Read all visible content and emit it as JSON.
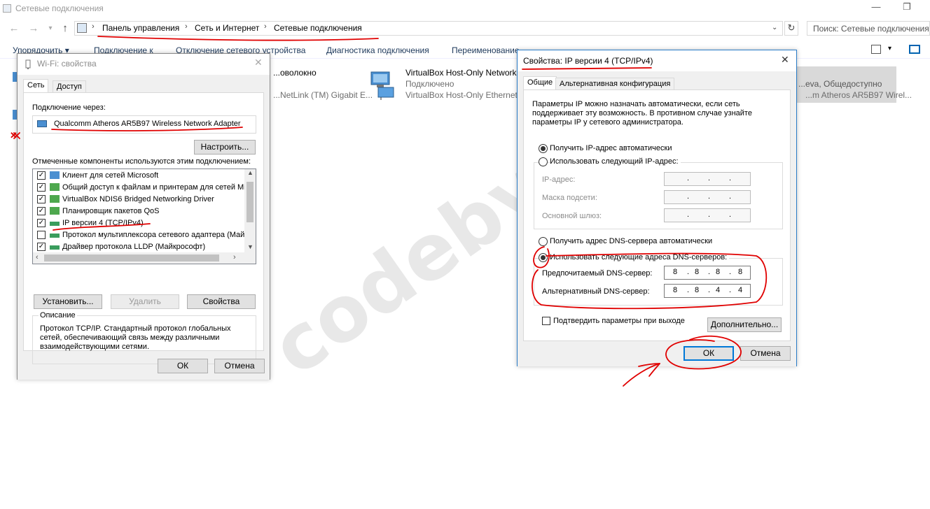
{
  "explorer": {
    "title": "Сетевые подключения",
    "breadcrumb": [
      "Панель управления",
      "Сеть и Интернет",
      "Сетевые подключения"
    ],
    "search_placeholder": "Поиск: Сетевые подключения",
    "commands": [
      "Упорядочить ▾",
      "Подключение к",
      "Отключение сетевого устройства",
      "Диагностика подключения",
      "Переименование"
    ],
    "items": [
      {
        "name": "...оволокно",
        "sub": "...NetLink (TM) Gigabit E..."
      },
      {
        "name": "VirtualBox Host-Only Network",
        "status": "Подключено",
        "sub": "VirtualBox Host-Only Ethernet"
      },
      {
        "name": "...eva, Общедоступно",
        "sub": "...m Atheros AR5B97 Wirel..."
      }
    ]
  },
  "wifi_dialog": {
    "title": "Wi-Fi: свойства",
    "tabs": [
      "Сеть",
      "Доступ"
    ],
    "connect_via_label": "Подключение через:",
    "adapter": "Qualcomm Atheros AR5B97 Wireless Network Adapter",
    "configure_button": "Настроить...",
    "components_label": "Отмеченные компоненты используются этим подключением:",
    "components": [
      {
        "name": "Клиент для сетей Microsoft",
        "checked": true,
        "icon": "network-client-icon"
      },
      {
        "name": "Общий доступ к файлам и принтерам для сетей Mi",
        "checked": true,
        "icon": "network-service-icon"
      },
      {
        "name": "VirtualBox NDIS6 Bridged Networking Driver",
        "checked": true,
        "icon": "network-service-icon"
      },
      {
        "name": "Планировщик пакетов QoS",
        "checked": true,
        "icon": "network-service-icon"
      },
      {
        "name": "IP версии 4 (TCP/IPv4)",
        "checked": true,
        "icon": "protocol-icon"
      },
      {
        "name": "Протокол мультиплексора сетевого адаптера (Май",
        "checked": false,
        "icon": "protocol-icon"
      },
      {
        "name": "Драйвер протокола LLDP (Майкрософт)",
        "checked": true,
        "icon": "protocol-icon"
      }
    ],
    "install_button": "Установить...",
    "remove_button": "Удалить",
    "properties_button": "Свойства",
    "description_title": "Описание",
    "description": "Протокол TCP/IP. Стандартный протокол глобальных сетей, обеспечивающий связь между различными взаимодействующими сетями.",
    "ok": "ОК",
    "cancel": "Отмена"
  },
  "ipv4_dialog": {
    "title": "Свойства: IP версии 4 (TCP/IPv4)",
    "tabs": [
      "Общие",
      "Альтернативная конфигурация"
    ],
    "info": "Параметры IP можно назначать автоматически, если сеть поддерживает эту возможность. В противном случае узнайте параметры IP у сетевого администратора.",
    "ip_auto": "Получить IP-адрес автоматически",
    "ip_manual": "Использовать следующий IP-адрес:",
    "ip_address_label": "IP-адрес:",
    "subnet_label": "Маска подсети:",
    "gateway_label": "Основной шлюз:",
    "dns_auto": "Получить адрес DNS-сервера автоматически",
    "dns_manual": "Использовать следующие адреса DNS-серверов:",
    "preferred_dns_label": "Предпочитаемый DNS-сервер:",
    "preferred_dns": [
      "8",
      "8",
      "8",
      "8"
    ],
    "alternate_dns_label": "Альтернативный DNS-сервер:",
    "alternate_dns": [
      "8",
      "8",
      "4",
      "4"
    ],
    "validate_label": "Подтвердить параметры при выходе",
    "advanced_button": "Дополнительно...",
    "ok": "ОК",
    "cancel": "Отмена",
    "ip_auto_selected": true,
    "dns_manual_selected": true,
    "validate_checked": false
  },
  "watermark": "codeby.net",
  "colors": {
    "annotation": "#e00000",
    "link": "#1e395b",
    "accent": "#0078d7"
  }
}
